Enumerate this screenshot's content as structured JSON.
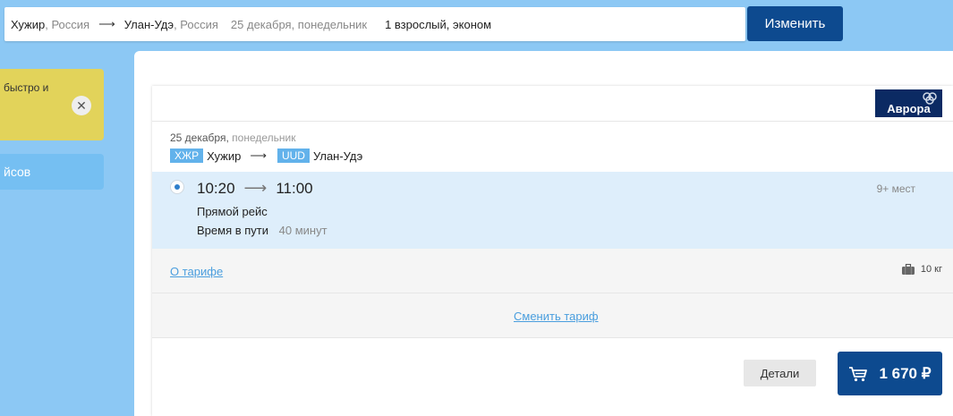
{
  "search": {
    "from_city": "Хужир",
    "from_country": ", Россия",
    "to_city": "Улан-Удэ",
    "to_country": ", Россия",
    "date": "25 декабря, понедельник",
    "passengers": "1 взрослый, эконом",
    "change_label": "Изменить"
  },
  "sidebar": {
    "promo_text": "быстро и",
    "nav_label": "йсов"
  },
  "card": {
    "airline_logo": "Аврора",
    "date": "25 декабря,",
    "weekday": "понедельник",
    "from_code": "ХЖР",
    "from_city": "Хужир",
    "to_code": "UUD",
    "to_city": "Улан-Удэ",
    "depart": "10:20",
    "arrive": "11:00",
    "seats": "9+ мест",
    "flight_type": "Прямой рейс",
    "duration_label": "Время в пути",
    "duration_value": "40 минут",
    "tariff_link": "О тарифе",
    "baggage": "10 кг",
    "change_tariff": "Сменить тариф",
    "details_label": "Детали",
    "price": "1 670 ₽"
  },
  "colors": {
    "background": "#8cc8f4",
    "primary_button": "#0d4a8f",
    "code_badge": "#62b2eb",
    "segment_bg": "#deeefb",
    "link": "#4a9ede"
  }
}
